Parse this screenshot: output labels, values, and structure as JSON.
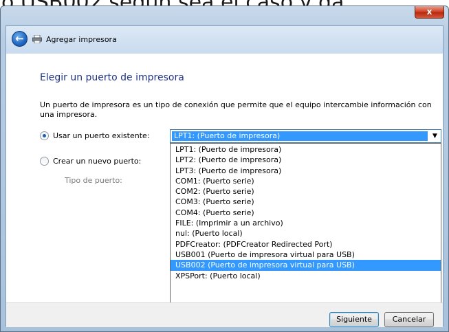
{
  "background_caption": "o USB002 según sea el caso y da",
  "window": {
    "close_label": "x",
    "wizard_title": "Agregar impresora"
  },
  "page": {
    "title": "Elegir un puerto de impresora",
    "description": "Un puerto de impresora es un tipo de conexión que permite que el equipo intercambie información con una impresora."
  },
  "options": {
    "use_existing_label": "Usar un puerto existente:",
    "create_new_label": "Crear un nuevo puerto:",
    "port_type_label": "Tipo de puerto:"
  },
  "combo": {
    "selected_value": "LPT1: (Puerto de impresora)",
    "items": [
      "LPT1: (Puerto de impresora)",
      "LPT2: (Puerto de impresora)",
      "LPT3: (Puerto de impresora)",
      "COM1: (Puerto serie)",
      "COM2: (Puerto serie)",
      "COM3: (Puerto serie)",
      "COM4: (Puerto serie)",
      "FILE: (Imprimir a un archivo)",
      "nul: (Puerto local)",
      "PDFCreator: (PDFCreator Redirected Port)",
      "USB001 (Puerto de impresora virtual para USB)",
      "USB002 (Puerto de impresora virtual para USB)",
      "XPSPort: (Puerto local)"
    ],
    "highlighted_item": "USB002 (Puerto de impresora virtual para USB)"
  },
  "buttons": {
    "next_label": "Siguiente",
    "cancel_label": "Cancelar"
  },
  "colors": {
    "title_blue": "#1e3287",
    "selection": "#3399ff",
    "close_red": "#c8391d"
  },
  "icons": {
    "back": "back-arrow-icon",
    "printer": "printer-icon",
    "dropdown": "chevron-down-icon"
  }
}
